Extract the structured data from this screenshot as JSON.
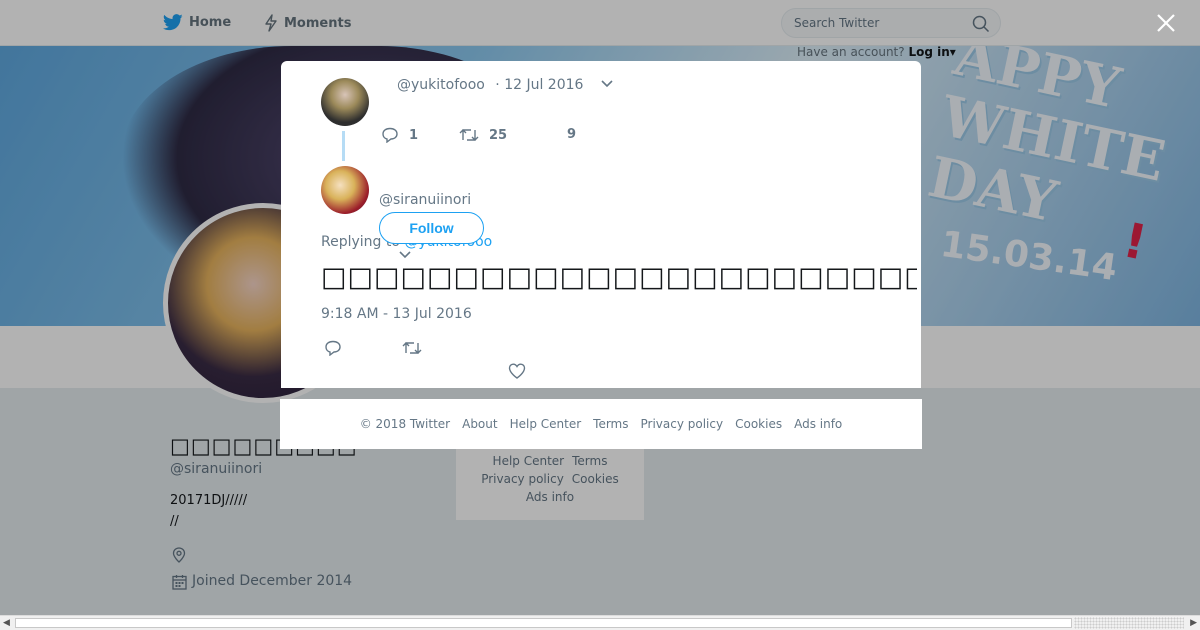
{
  "nav": {
    "home_label": "Home",
    "moments_label": "Moments",
    "home_icon": "twitter-bird-icon",
    "moments_icon": "lightning-icon"
  },
  "search": {
    "placeholder": "Search Twitter",
    "icon": "search-icon"
  },
  "account": {
    "prompt": "Have an account?",
    "login_label": "Log in"
  },
  "banner": {
    "line1": "APPY",
    "line2": "WHITE",
    "line3": "DAY",
    "exclaim": "!",
    "date": "15.03.14"
  },
  "profile": {
    "name": "□□□□□□□□□",
    "handle": "@siranuiinori",
    "bio_line1": "20171DJ/////",
    "bio_line2": "//",
    "location_icon": "map-pin-icon",
    "joined": "Joined December 2014",
    "calendar_icon": "calendar-icon"
  },
  "side_footer": {
    "help": "Help Center",
    "terms": "Terms",
    "privacy": "Privacy policy",
    "cookies": "Cookies",
    "ads": "Ads info"
  },
  "modal": {
    "parent_tweet": {
      "handle": "@yukitofooo",
      "date": "· 12 Jul 2016",
      "replies": "1",
      "retweets": "25",
      "likes": "9"
    },
    "tweet": {
      "handle": "@siranuiinori",
      "follow_label": "Follow",
      "replying_prefix": "Replying to",
      "replying_handle": "@yukitofooo",
      "text": "□□□□□□□□□□□□□□□□□□□□□□□□□□□□□□□□□□□",
      "timestamp": "9:18 AM - 13 Jul 2016"
    }
  },
  "footer": {
    "copyright": "© 2018 Twitter",
    "about": "About",
    "help": "Help Center",
    "terms": "Terms",
    "privacy": "Privacy policy",
    "cookies": "Cookies",
    "ads": "Ads info"
  },
  "colors": {
    "accent": "#1da1f2",
    "muted_text": "#657786",
    "overlay": "rgba(0,0,0,0.30)"
  }
}
